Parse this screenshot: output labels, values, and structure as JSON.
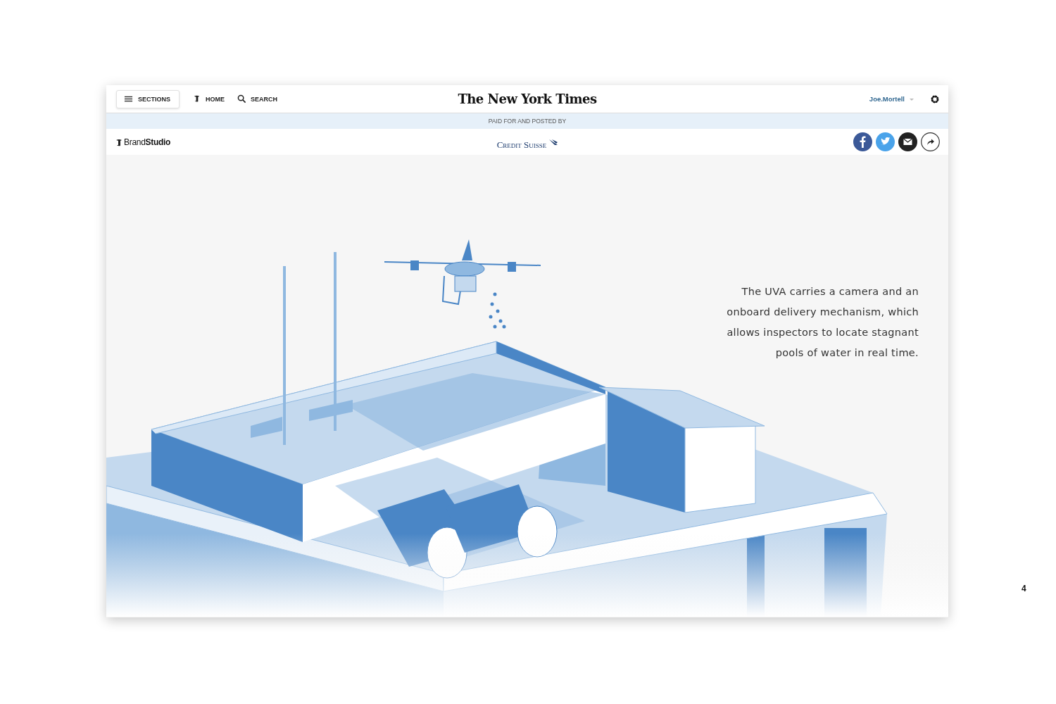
{
  "header": {
    "sections_button": "SECTIONS",
    "home_link": "HOME",
    "search_link": "SEARCH",
    "masthead": "The New York Times",
    "user": "Joe.Mortell"
  },
  "sponsor_band": {
    "label": "PAID FOR AND POSTED BY"
  },
  "brand_row": {
    "brand": "Brand**Studio**",
    "sponsor": "Credit Suisse"
  },
  "article": {
    "caption": "The UVA carries a camera and an onboard delivery mechanism, which allows inspectors to locate stagnant pools of water in real time."
  },
  "page_number": "4"
}
